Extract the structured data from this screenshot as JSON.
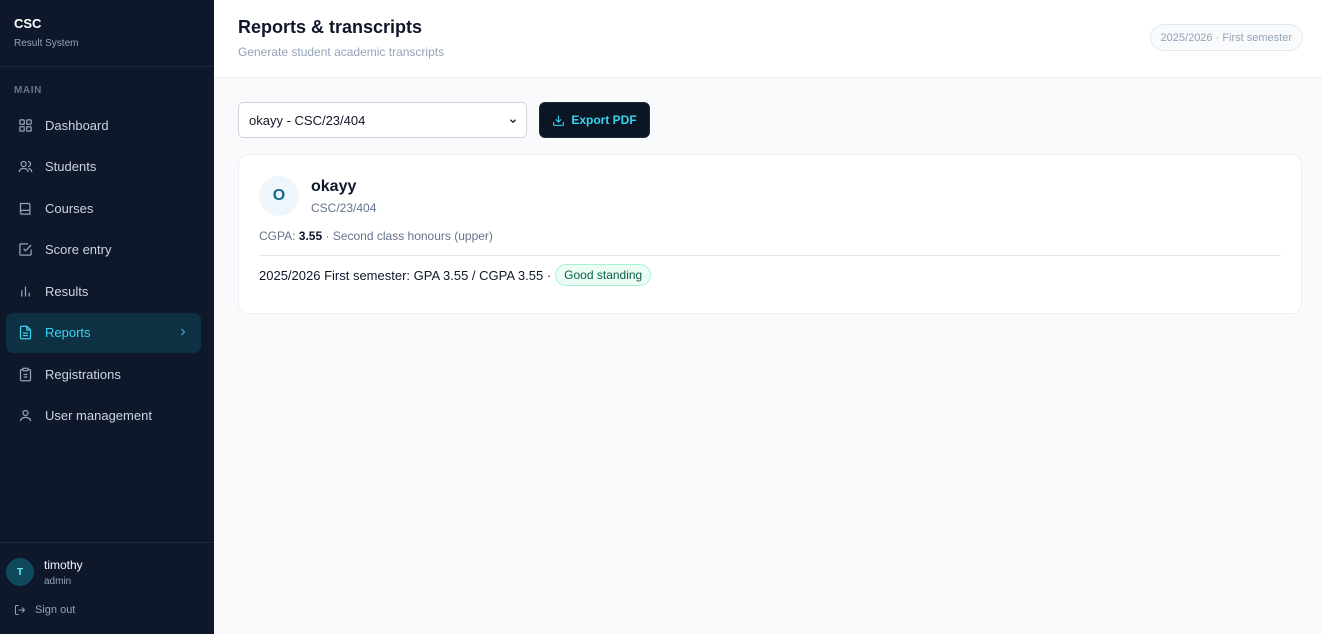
{
  "brand": {
    "name": "CSC",
    "subtitle": "Result System"
  },
  "sidebar": {
    "section_label": "MAIN",
    "items": [
      {
        "label": "Dashboard",
        "icon": "grid-icon"
      },
      {
        "label": "Students",
        "icon": "users-icon"
      },
      {
        "label": "Courses",
        "icon": "book-icon"
      },
      {
        "label": "Score entry",
        "icon": "check-square-icon"
      },
      {
        "label": "Results",
        "icon": "bar-chart-icon"
      },
      {
        "label": "Reports",
        "icon": "file-text-icon",
        "active": true
      },
      {
        "label": "Registrations",
        "icon": "clipboard-icon"
      },
      {
        "label": "User management",
        "icon": "user-icon"
      }
    ]
  },
  "user": {
    "initial": "T",
    "name": "timothy",
    "role": "admin",
    "signout_label": "Sign out"
  },
  "header": {
    "title": "Reports & transcripts",
    "subtitle": "Generate student academic transcripts",
    "term_pill": "2025/2026 · First semester"
  },
  "toolbar": {
    "student_select_value": "okayy - CSC/23/404",
    "export_label": "Export PDF"
  },
  "student": {
    "initial": "O",
    "name": "okayy",
    "matric": "CSC/23/404",
    "cgpa_label": "CGPA:",
    "cgpa_value": "3.55",
    "class_text": "· Second class honours (upper)",
    "semester_line": "2025/2026 First semester: GPA 3.55 / CGPA 3.55 ·",
    "standing_badge": "Good standing"
  },
  "colors": {
    "sidebar_bg": "#0f172a",
    "accent": "#38d5ee",
    "badge_bg": "#ecfdf5",
    "badge_text": "#065f46"
  }
}
